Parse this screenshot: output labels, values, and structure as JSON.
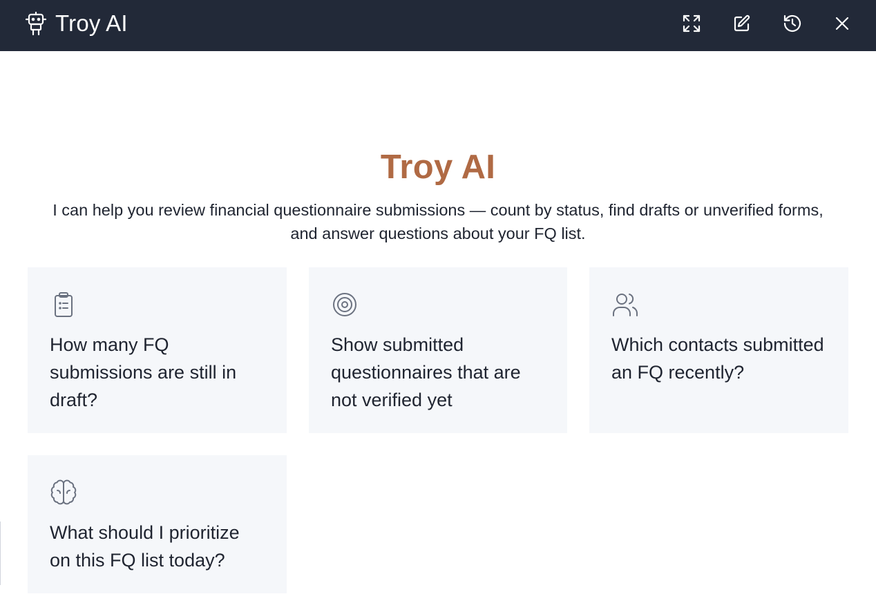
{
  "header": {
    "title": "Troy AI",
    "icons": [
      "robot-icon",
      "expand-icon",
      "edit-icon",
      "history-icon",
      "close-icon"
    ]
  },
  "hero": {
    "title": "Troy AI",
    "subtitle": "I can help you review financial questionnaire submissions — count by status, find drafts or unverified forms, and answer questions about your FQ list."
  },
  "suggestions": [
    {
      "icon": "clipboard-icon",
      "text": "How many FQ submissions are still in draft?"
    },
    {
      "icon": "target-icon",
      "text": "Show submitted questionnaires that are not verified yet"
    },
    {
      "icon": "users-icon",
      "text": "Which contacts submitted an FQ recently?"
    },
    {
      "icon": "brain-icon",
      "text": "What should I prioritize on this FQ list today?"
    }
  ],
  "colors": {
    "header_bg": "#222938",
    "accent_title": "#b06a44",
    "card_bg": "#f5f7fa",
    "icon_gray": "#6b7280"
  }
}
